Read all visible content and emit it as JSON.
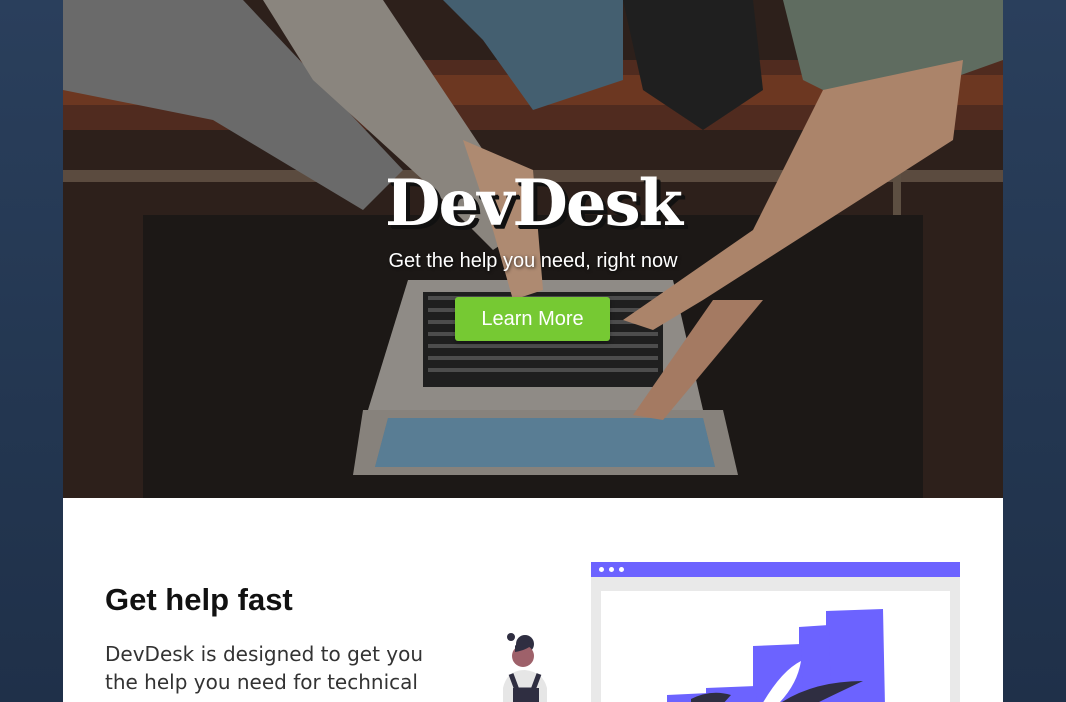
{
  "hero": {
    "logo": "DevDesk",
    "tagline": "Get the help you need, right now",
    "cta_label": "Learn More"
  },
  "feature": {
    "title": "Get help fast",
    "text": "DevDesk is designed to get you the help you need for technical"
  },
  "colors": {
    "background": "#233650",
    "cta": "#76c933",
    "illustration_accent": "#6c63ff"
  }
}
